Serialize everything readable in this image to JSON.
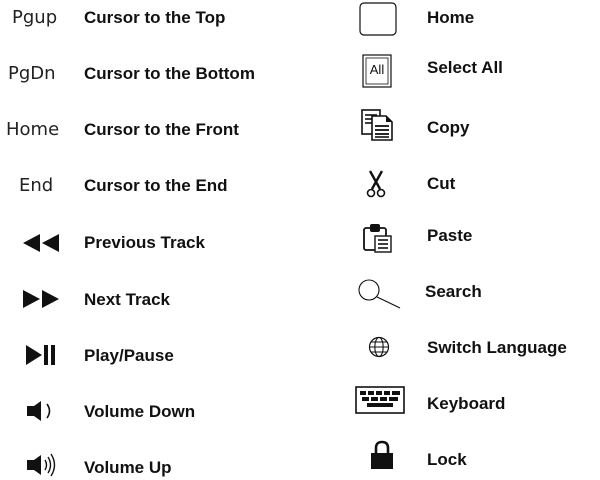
{
  "left_column": [
    {
      "key": "Pgup",
      "description": "Cursor to the Top"
    },
    {
      "key": "PgDn",
      "description": "Cursor to the Bottom"
    },
    {
      "key": "Home",
      "description": "Cursor to the Front"
    },
    {
      "key": "End",
      "description": "Cursor to the End"
    },
    {
      "icon": "previous-track-icon",
      "description": "Previous Track"
    },
    {
      "icon": "next-track-icon",
      "description": "Next Track"
    },
    {
      "icon": "play-pause-icon",
      "description": "Play/Pause"
    },
    {
      "icon": "volume-down-icon",
      "description": "Volume Down"
    },
    {
      "icon": "volume-up-icon",
      "description": "Volume Up"
    }
  ],
  "right_column": [
    {
      "icon": "home-key-icon",
      "description": "Home"
    },
    {
      "icon": "select-all-icon",
      "icon_text": "All",
      "description": "Select All"
    },
    {
      "icon": "copy-icon",
      "description": "Copy"
    },
    {
      "icon": "scissors-icon",
      "description": "Cut"
    },
    {
      "icon": "clipboard-icon",
      "description": "Paste"
    },
    {
      "icon": "search-icon",
      "description": "Search"
    },
    {
      "icon": "globe-icon",
      "description": "Switch Language"
    },
    {
      "icon": "keyboard-icon",
      "description": "Keyboard"
    },
    {
      "icon": "lock-icon",
      "description": "Lock"
    }
  ],
  "colors": {
    "text": "#111111",
    "icon": "#111111",
    "background": "#ffffff"
  }
}
